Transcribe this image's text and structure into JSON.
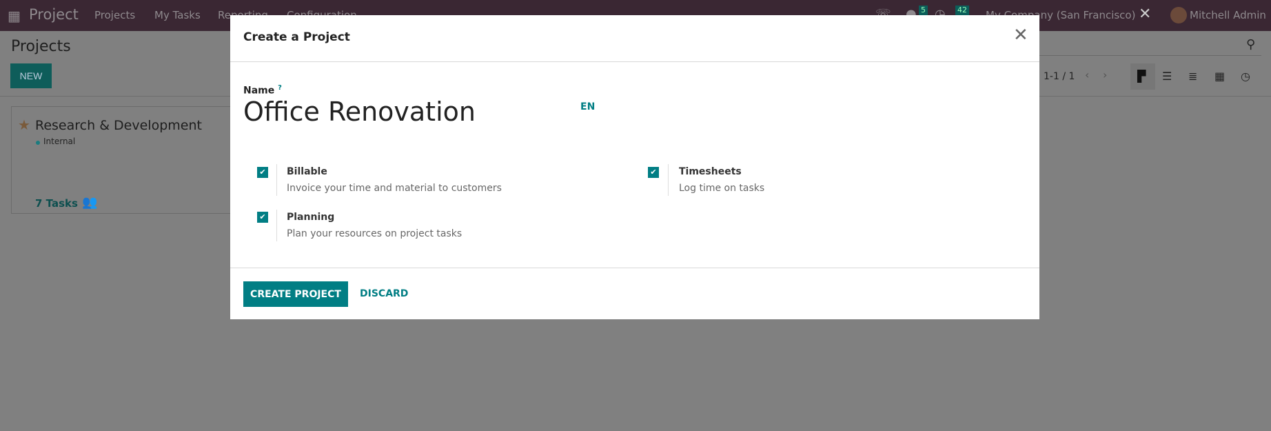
{
  "navbar": {
    "app_name": "Project",
    "menu": [
      "Projects",
      "My Tasks",
      "Reporting",
      "Configuration"
    ],
    "chat_badge": "5",
    "activity_badge": "42",
    "company": "My Company (San Francisco)",
    "user": "Mitchell Admin"
  },
  "control_panel": {
    "title": "Projects",
    "new_label": "NEW",
    "pager": "1-1 / 1"
  },
  "kanban": {
    "card": {
      "title": "Research & Development",
      "tag": "Internal",
      "tasks": "7 Tasks"
    }
  },
  "modal": {
    "title": "Create a Project",
    "name_label": "Name",
    "name_help": "?",
    "name_value": "Office Renovation",
    "lang": "EN",
    "options": [
      {
        "label": "Billable",
        "desc": "Invoice your time and material to customers",
        "checked": true
      },
      {
        "label": "Timesheets",
        "desc": "Log time on tasks",
        "checked": true
      },
      {
        "label": "Planning",
        "desc": "Plan your resources on project tasks",
        "checked": true
      }
    ],
    "create_label": "CREATE PROJECT",
    "discard_label": "DISCARD"
  },
  "colors": {
    "accent": "#017e84",
    "navbar": "#714b67"
  }
}
